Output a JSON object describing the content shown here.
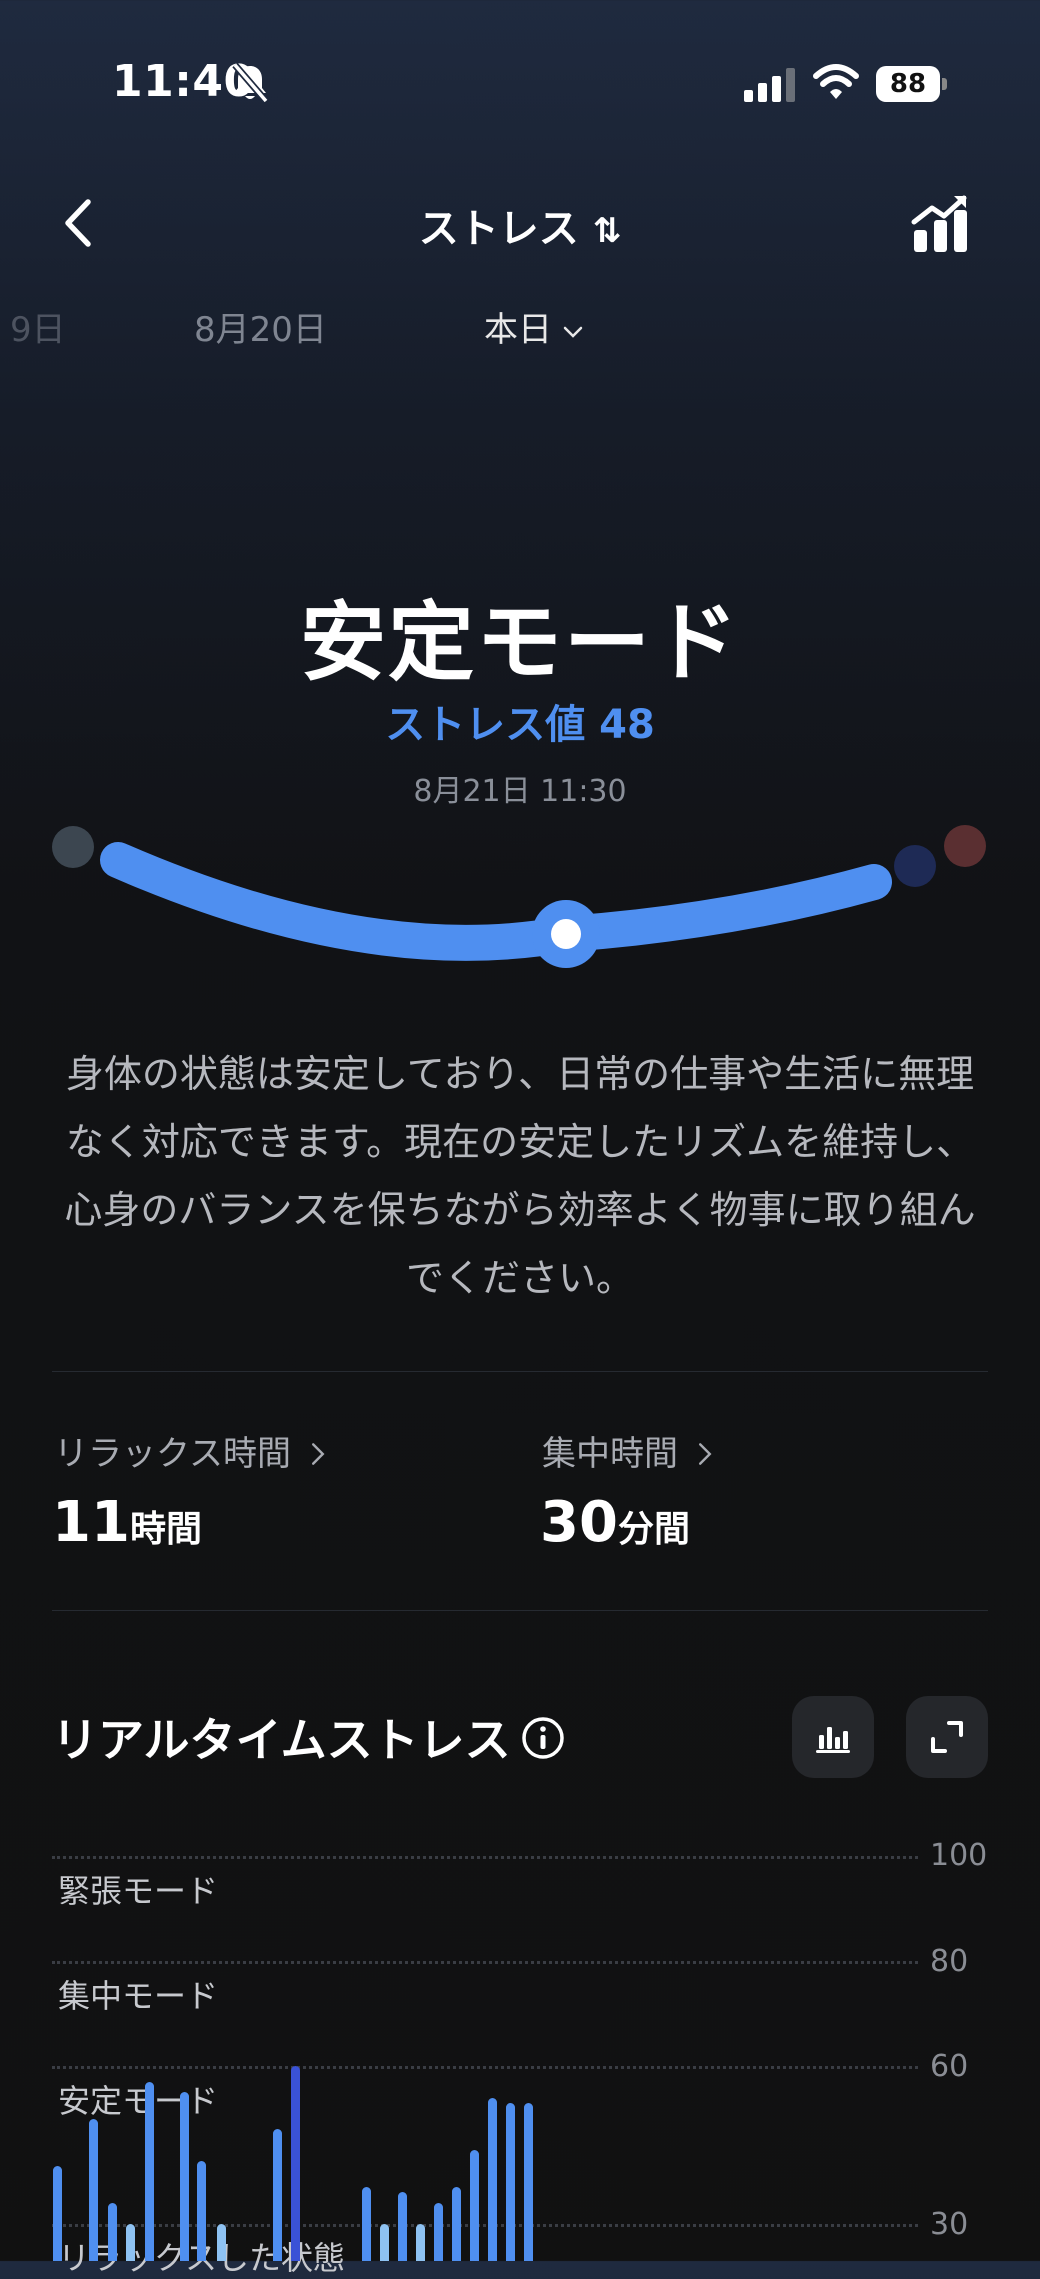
{
  "status_bar": {
    "time": "11:40",
    "battery": "88",
    "icons": [
      "bell-slash-icon",
      "signal-icon",
      "wifi-icon",
      "battery-icon"
    ]
  },
  "nav": {
    "title": "ストレス",
    "sort_glyph": "⇅",
    "back_icon": "chevron-left-icon",
    "trend_icon": "trend-chart-icon"
  },
  "date_tabs": {
    "prev2": "9日",
    "prev1": "8月20日",
    "current": "本日"
  },
  "summary": {
    "mode": "安定モード",
    "stress_value": "ストレス値 48",
    "timestamp": "8月21日 11:30",
    "gauge_level": 48,
    "description": "身体の状態は安定しており、日常の仕事や生活に無理なく対応できます。現在の安定したリズムを維持し、心身のバランスを保ちながら効率よく物事に取り組んでください。"
  },
  "metrics": {
    "relax": {
      "label": "リラックス時間",
      "value": "11",
      "unit": "時間"
    },
    "focus": {
      "label": "集中時間",
      "value": "30",
      "unit": "分間"
    }
  },
  "realtime": {
    "title": "リアルタイムストレス"
  },
  "colors": {
    "accent": "#4f8ff0",
    "bar_blue": "#4f8ff0",
    "bar_dark": "#3a52d6",
    "bar_light": "#8ec2f2"
  },
  "chart_data": {
    "type": "bar",
    "y_ticks": [
      "100",
      "80",
      "60",
      "30"
    ],
    "zones": [
      "緊張モード",
      "集中モード",
      "安定モード",
      "リラックスした状態"
    ],
    "values": [
      41,
      50,
      34,
      30,
      57,
      55,
      42,
      30,
      48,
      60,
      37,
      30,
      36,
      30,
      34,
      37,
      44,
      54,
      53,
      53
    ],
    "ylim": [
      0,
      100
    ]
  }
}
